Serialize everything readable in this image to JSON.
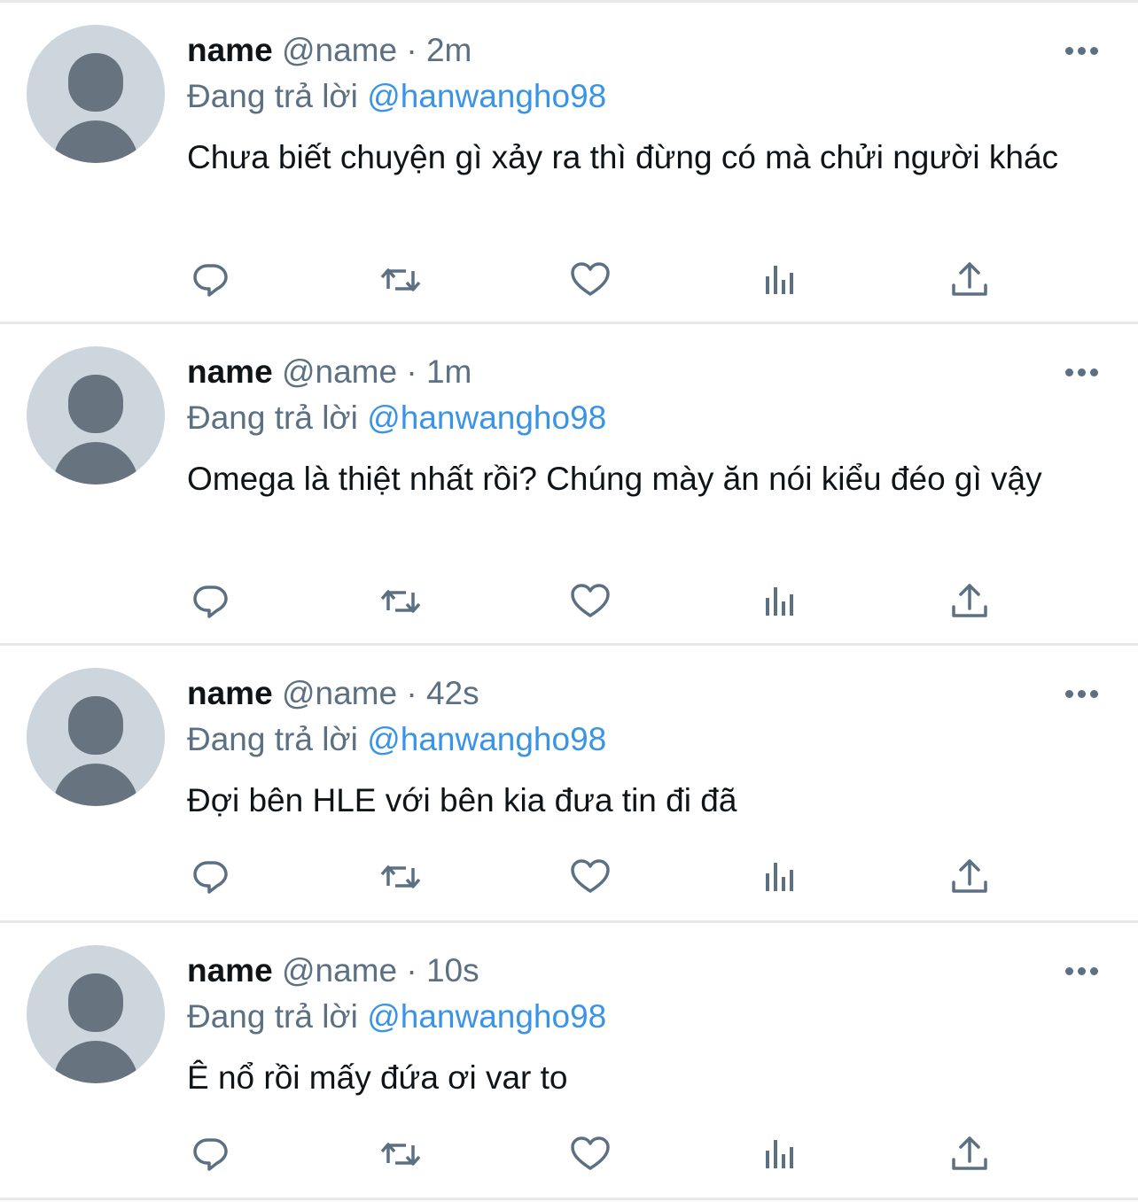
{
  "tweets": [
    {
      "name": "name",
      "handle": "@name",
      "separator": "·",
      "time": "2m",
      "reply_prefix": "Đang trả lời",
      "reply_to": "@hanwangho98",
      "text": "Chưa biết chuyện gì xảy ra thì đừng có mà chửi người khác"
    },
    {
      "name": "name",
      "handle": "@name",
      "separator": "·",
      "time": "1m",
      "reply_prefix": "Đang trả lời",
      "reply_to": "@hanwangho98",
      "text": "Omega là thiệt nhất rồi? Chúng mày ăn nói kiểu đéo gì vậy"
    },
    {
      "name": "name",
      "handle": "@name",
      "separator": "·",
      "time": "42s",
      "reply_prefix": "Đang trả lời",
      "reply_to": "@hanwangho98",
      "text": "Đợi bên HLE với bên kia đưa tin đi đã"
    },
    {
      "name": "name",
      "handle": "@name",
      "separator": "·",
      "time": "10s",
      "reply_prefix": "Đang trả lời",
      "reply_to": "@hanwangho98",
      "text": "Ê nổ rồi mấy đứa ơi var to"
    }
  ],
  "actions": [
    "reply-icon",
    "retweet-icon",
    "like-icon",
    "analytics-icon",
    "share-icon"
  ],
  "more_icon": "more-options-icon",
  "colors": {
    "name": "#0f1419",
    "muted": "#5b7083",
    "mention": "#3a94e6",
    "divider": "#e6e8ea",
    "avatar_bg": "#cdd6dd",
    "avatar_fg": "#67737f"
  }
}
